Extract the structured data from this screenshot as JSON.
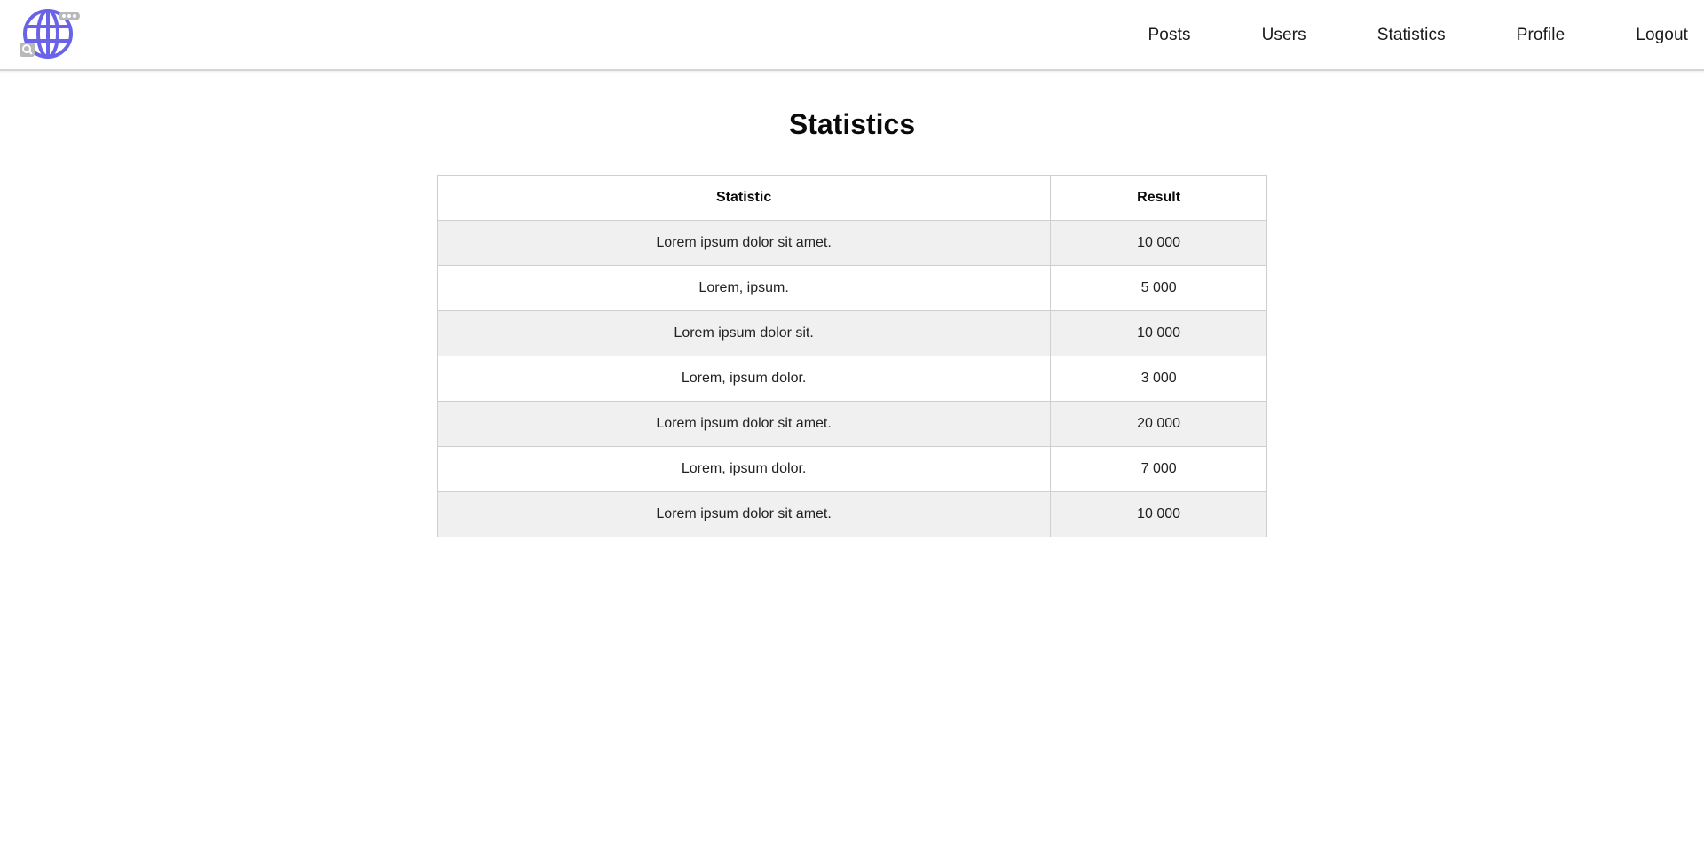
{
  "colors": {
    "logo_accent": "#6a63e8",
    "row_alt": "#f0f0f0",
    "border": "#cfcfcf"
  },
  "header": {
    "logo_icon": "globe-logo-icon",
    "nav": [
      {
        "label": "Posts"
      },
      {
        "label": "Users"
      },
      {
        "label": "Statistics"
      },
      {
        "label": "Profile"
      },
      {
        "label": "Logout"
      }
    ]
  },
  "main": {
    "title": "Statistics",
    "table": {
      "columns": [
        "Statistic",
        "Result"
      ],
      "rows": [
        [
          "Lorem ipsum dolor sit amet.",
          "10 000"
        ],
        [
          "Lorem, ipsum.",
          "5 000"
        ],
        [
          "Lorem ipsum dolor sit.",
          "10 000"
        ],
        [
          "Lorem, ipsum dolor.",
          "3 000"
        ],
        [
          "Lorem ipsum dolor sit amet.",
          "20 000"
        ],
        [
          "Lorem, ipsum dolor.",
          "7 000"
        ],
        [
          "Lorem ipsum dolor sit amet.",
          "10 000"
        ]
      ]
    }
  }
}
